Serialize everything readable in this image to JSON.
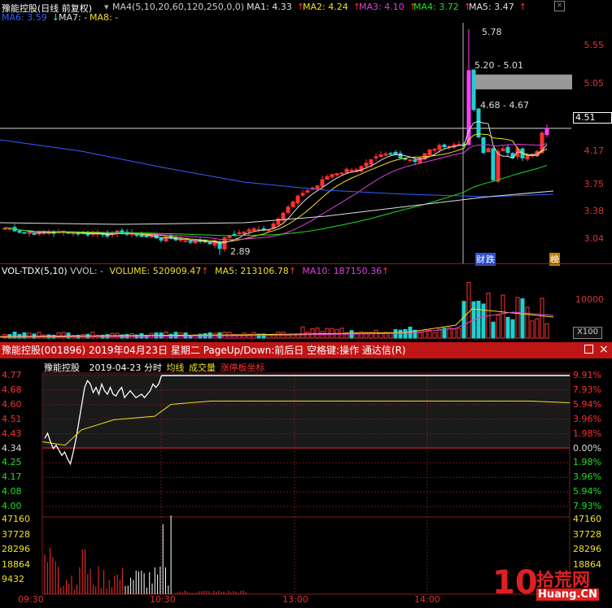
{
  "kline": {
    "title": "豫能控股(日线 前复权)",
    "ma_params": "MA4(5,10,20,60,120,250,0,0)",
    "ma": [
      {
        "label": "MA1: 4.33",
        "color": "#e0e0e0"
      },
      {
        "label": "MA2: 4.24",
        "color": "#f0e020"
      },
      {
        "label": "MA3: 4.10",
        "color": "#e040e0"
      },
      {
        "label": "MA4: 3.72",
        "color": "#20e020"
      },
      {
        "label": "MA5: 3.47",
        "color": "#e0e0e0"
      },
      {
        "label": "MA6: 3.59",
        "color": "#3060ff"
      },
      {
        "label": "MA7: -",
        "color": "#e0e0e0"
      },
      {
        "label": "MA8: -",
        "color": "#f0e020"
      }
    ],
    "price_axis": [
      "5.55",
      "5.05",
      "4.51",
      "4.17",
      "3.75",
      "3.38",
      "3.04"
    ],
    "current_price": "4.51",
    "annotations": {
      "high": "5.78",
      "gap_range": "5.20 - 5.01",
      "mid_range": "4.68 - 4.67",
      "low": "2.89"
    },
    "badges": {
      "cai": "财",
      "die": "跌",
      "bang": "榜"
    }
  },
  "volume": {
    "name": "VOL-TDX(5,10)",
    "vvol": "VVOL: -",
    "volume": "VOLUME: 520909.47",
    "ma5": "MA5: 213106.78",
    "ma10": "MA10: 187150.36",
    "axis_label": "10000",
    "unit": "X100"
  },
  "title_bar": {
    "text": "豫能控股(001896) 2019年04月23日 星期二 PageUp/Down:前后日 空格键:操作 通达信(R)"
  },
  "intraday": {
    "name": "豫能控股",
    "date": "2019-04-23 分时",
    "avg_label": "均线",
    "vol_label": "成交量",
    "limit_label": "涨停板坐标",
    "left_axis": [
      "4.77",
      "4.68",
      "4.60",
      "4.51",
      "4.43",
      "4.34",
      "4.25",
      "4.17",
      "4.08",
      "4.00"
    ],
    "right_axis": [
      "9.91%",
      "7.93%",
      "5.94%",
      "3.96%",
      "1.98%",
      "0.00%",
      "1.98%",
      "3.96%",
      "5.94%",
      "7.93%"
    ],
    "vol_axis": [
      "47160",
      "37728",
      "28296",
      "18864",
      "9432"
    ],
    "vol_axis_right": [
      "47160",
      "37728",
      "28296",
      "18864"
    ],
    "times": [
      "09:30",
      "10:30",
      "13:00",
      "14:00"
    ]
  },
  "watermark": {
    "num": "10",
    "cn": "拾荒网",
    "domain": "Huang.CN"
  },
  "colors": {
    "up": "#ff3030",
    "down": "#20d0d0",
    "accent": "#c01515"
  }
}
